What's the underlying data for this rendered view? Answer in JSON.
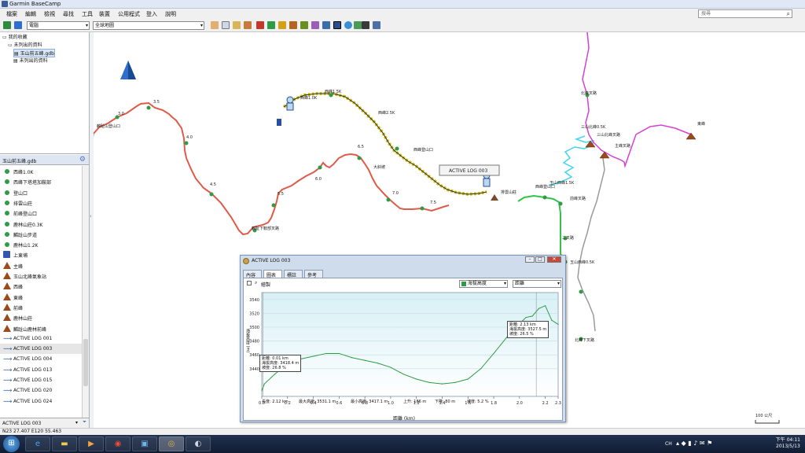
{
  "window": {
    "title": "Garmin BaseCamp"
  },
  "menu": [
    "檔案",
    "編輯",
    "檢視",
    "尋找",
    "工具",
    "裝置",
    "公用程式",
    "登入",
    "說明"
  ],
  "search": {
    "placeholder": "搜尋"
  },
  "toolbar": {
    "device_combo": "電腦",
    "map_combo": "全球地圖"
  },
  "tree": {
    "root": "我的收藏",
    "items": [
      "未列出的資料",
      "玉山前五峰.gdb",
      "未列出的資料"
    ]
  },
  "library": {
    "title": "玉山前五峰.gdb",
    "items": [
      {
        "label": "西峰1.0K",
        "icon": "waypoint-icon"
      },
      {
        "label": "西峰下塔塔加鞍部",
        "icon": "waypoint-icon"
      },
      {
        "label": "登山口",
        "icon": "waypoint-icon"
      },
      {
        "label": "排雲山莊",
        "icon": "waypoint-icon"
      },
      {
        "label": "前峰登山口",
        "icon": "waypoint-icon"
      },
      {
        "label": "鹿林山莊0.3K",
        "icon": "waypoint-icon"
      },
      {
        "label": "麟趾山步道",
        "icon": "waypoint-icon"
      },
      {
        "label": "鹿林山1.2K",
        "icon": "waypoint-icon"
      },
      {
        "label": "上東埔",
        "icon": "bus-icon"
      },
      {
        "label": "主峰",
        "icon": "mountain-icon"
      },
      {
        "label": "玉山北峰氣象站",
        "icon": "mountain-icon"
      },
      {
        "label": "西峰",
        "icon": "mountain-icon"
      },
      {
        "label": "東峰",
        "icon": "mountain-icon"
      },
      {
        "label": "前峰",
        "icon": "mountain-icon"
      },
      {
        "label": "鹿林山莊",
        "icon": "mountain-icon"
      },
      {
        "label": "麟趾山鹿林前峰",
        "icon": "mountain-icon"
      },
      {
        "label": "ACTIVE LOG 001",
        "icon": "track-icon"
      },
      {
        "label": "ACTIVE LOG 003",
        "icon": "track-icon"
      },
      {
        "label": "ACTIVE LOG 004",
        "icon": "track-icon"
      },
      {
        "label": "ACTIVE LOG 013",
        "icon": "track-icon"
      },
      {
        "label": "ACTIVE LOG 015",
        "icon": "track-icon"
      },
      {
        "label": "ACTIVE LOG 020",
        "icon": "track-icon"
      },
      {
        "label": "ACTIVE LOG 024",
        "icon": "track-icon"
      }
    ],
    "selected_index": 17,
    "filter_value": "ACTIVE LOG 003"
  },
  "map": {
    "labels": {
      "l30": "3.0",
      "l35": "3.5",
      "l40": "4.0",
      "l45": "4.5",
      "l55": "5.5",
      "l60": "6.0",
      "l65": "6.5",
      "l70": "7.0",
      "l75": "7.5",
      "start": "麟趾山登山口",
      "bottom": "麟趾下鞍部叉路",
      "saddle": "大斜坡",
      "w1": "西峰1.0K",
      "w2": "西峰1.5K",
      "w3": "西峰2.5K",
      "w4": "西峰登山口",
      "w5": "排雲山莊",
      "e1": "西峰登山口",
      "e2": "北峰叉路",
      "e3": "三山北峰0.5K",
      "e4": "三山北峰叉路",
      "e5": "東峰",
      "e6": "主峰叉路",
      "e7": "玉山西峰1.5K",
      "e8": "前峰叉路",
      "e9": "玉山西峰0.5K",
      "e10": "二叉路",
      "e11": "北峰下叉路",
      "tip": "ACTIVE LOG 003",
      "scale": "100 公尺"
    }
  },
  "dialog": {
    "title": "ACTIVE LOG 003",
    "tabs": [
      "內容",
      "圖表",
      "標註",
      "參考"
    ],
    "active_tab": 1,
    "checkbox_label": "繪製",
    "y_combo": "海拔高度",
    "x_combo": "距離",
    "tooltip_left": [
      "距離: 0.01 km",
      "海拔高度: 3418.4 m",
      "坡度: 26.8 %"
    ],
    "tooltip_right": [
      "距離: 2.13 km",
      "海拔高度: 3527.5 m",
      "坡度: 26.5 %"
    ],
    "stats": [
      "長度: 2.12 km",
      "最大高度: 3531.1 m",
      "最小高度: 3417.1 m",
      "上升: 186 m",
      "下降: 80 m",
      "坡度: 5.2 %"
    ]
  },
  "chart_data": {
    "type": "line",
    "title": "",
    "xlabel": "距離 (km)",
    "ylabel": "海拔高度 (m)",
    "xlim": [
      0.0,
      2.3
    ],
    "ylim": [
      3400,
      3550
    ],
    "xticks": [
      "0.0",
      "0.2",
      "0.4",
      "0.6",
      "0.8",
      "1.0",
      "1.2",
      "1.4",
      "1.6",
      "1.8",
      "2.0",
      "2.2",
      "2.3"
    ],
    "yticks": [
      "3540",
      "3520",
      "3500",
      "3480",
      "3460",
      "3440"
    ],
    "series": [
      {
        "name": "",
        "x": [
          0.0,
          0.02,
          0.1,
          0.2,
          0.3,
          0.4,
          0.5,
          0.6,
          0.7,
          0.8,
          0.9,
          1.0,
          1.1,
          1.2,
          1.3,
          1.4,
          1.5,
          1.6,
          1.7,
          1.8,
          1.9,
          2.0,
          2.05,
          2.1,
          2.15,
          2.2,
          2.25,
          2.3
        ],
        "y": [
          3408,
          3418,
          3432,
          3447,
          3454,
          3458,
          3462,
          3462,
          3456,
          3452,
          3448,
          3442,
          3432,
          3425,
          3420,
          3418,
          3420,
          3425,
          3440,
          3462,
          3485,
          3505,
          3514,
          3516,
          3527,
          3531,
          3510,
          3504
        ]
      }
    ]
  },
  "status": {
    "coords": "N23 27.407 E120 55.463"
  },
  "taskbar": {
    "time": "下午 04:11",
    "date": "2013/5/13",
    "lang": "CH"
  }
}
